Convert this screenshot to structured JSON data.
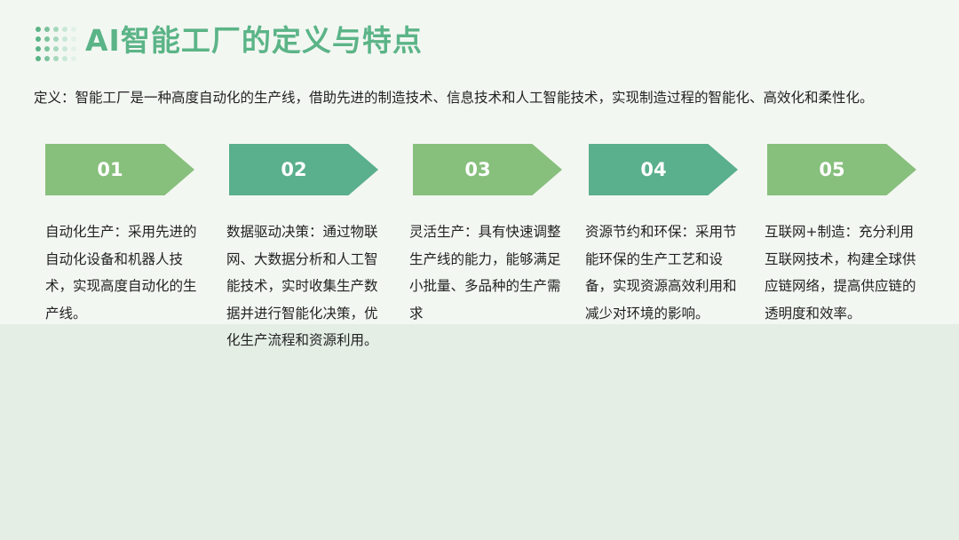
{
  "title": "AI智能工厂的定义与特点",
  "definition": "定义：智能工厂是一种高度自动化的生产线，借助先进的制造技术、信息技术和人工智能技术，实现制造过程的智能化、高效化和柔性化。",
  "colors": {
    "title": "#5bb487",
    "arrow_light": "#87bf7c",
    "arrow_dark": "#5aaf8d"
  },
  "features": [
    {
      "num": "01",
      "text": "自动化生产：采用先进的自动化设备和机器人技术，实现高度自动化的生产线。"
    },
    {
      "num": "02",
      "text": "数据驱动决策：通过物联网、大数据分析和人工智能技术，实时收集生产数据并进行智能化决策，优化生产流程和资源利用。"
    },
    {
      "num": "03",
      "text": "灵活生产：具有快速调整生产线的能力，能够满足小批量、多品种的生产需求"
    },
    {
      "num": "04",
      "text": "资源节约和环保：采用节能环保的生产工艺和设备，实现资源高效利用和减少对环境的影响。"
    },
    {
      "num": "05",
      "text": "互联网+制造：充分利用互联网技术，构建全球供应链网络，提高供应链的透明度和效率。"
    }
  ]
}
